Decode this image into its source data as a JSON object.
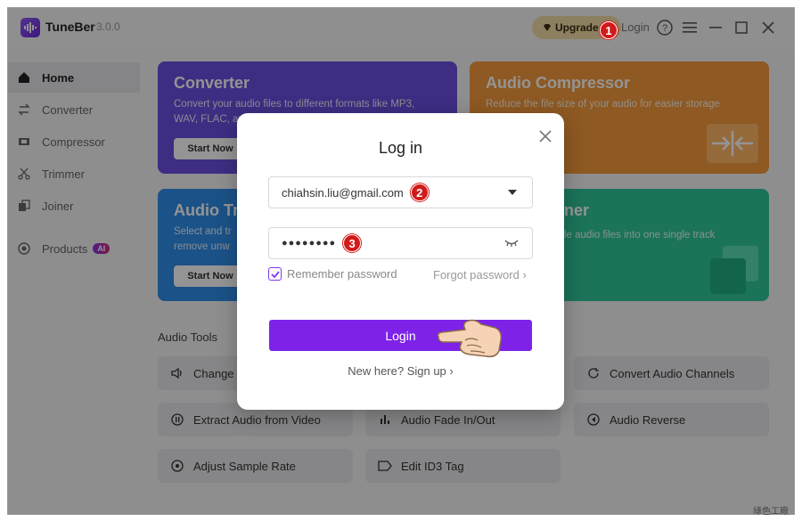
{
  "app": {
    "name": "TuneBer",
    "version": "3.0.0",
    "upgrade_label": "Upgrade",
    "login_label": "Login"
  },
  "sidebar": {
    "items": [
      {
        "label": "Home",
        "icon": "home-icon"
      },
      {
        "label": "Converter",
        "icon": "converter-icon"
      },
      {
        "label": "Compressor",
        "icon": "compressor-icon"
      },
      {
        "label": "Trimmer",
        "icon": "trimmer-icon"
      },
      {
        "label": "Joiner",
        "icon": "joiner-icon"
      },
      {
        "label": "Products",
        "icon": "products-icon",
        "badge": "AI"
      }
    ]
  },
  "cards": {
    "converter": {
      "title": "Converter",
      "desc": "Convert your audio files to different formats like MP3, WAV, FLAC, and",
      "button": "Start Now",
      "color": "#6c4fe0"
    },
    "compressor": {
      "title": "Audio Compressor",
      "desc": "Reduce the file size of your audio for easier storage",
      "color": "#f59a3c"
    },
    "trimmer": {
      "title": "Audio Tr",
      "desc": "Select and tr remove unw",
      "button": "Start Now",
      "color": "#2f8ee8"
    },
    "joiner": {
      "title": "ner",
      "desc": "le audio files into one single track",
      "color": "#2fc79a"
    }
  },
  "tools": {
    "section_label": "Audio Tools",
    "items": [
      {
        "label": "Change",
        "icon": "speaker-icon"
      },
      {
        "label": "Convert Audio Channels",
        "icon": "refresh-icon"
      },
      {
        "label": "Extract Audio from Video",
        "icon": "extract-icon"
      },
      {
        "label": "Audio Fade In/Out",
        "icon": "fade-icon"
      },
      {
        "label": "Audio Reverse",
        "icon": "reverse-icon"
      },
      {
        "label": "Adjust Sample Rate",
        "icon": "sample-rate-icon"
      },
      {
        "label": "Edit ID3 Tag",
        "icon": "tag-icon"
      }
    ]
  },
  "dialog": {
    "title": "Log in",
    "email": "chiahsin.liu@gmail.com",
    "password_masked": "●●●●●●●●",
    "remember_label": "Remember password",
    "remember_checked": true,
    "forgot_label": "Forgot password",
    "login_button": "Login",
    "signup_text": "New here? Sign up"
  },
  "annotations": {
    "step1": "1",
    "step2": "2",
    "step3": "3"
  },
  "watermark": "綠色工廠"
}
